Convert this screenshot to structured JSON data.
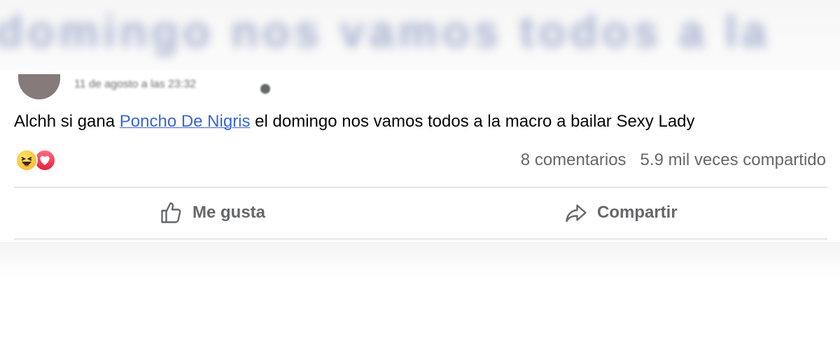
{
  "header": {
    "blurred_text": "domingo nos vamos todos a la",
    "date": "11 de agosto a las 23:32"
  },
  "post": {
    "text_before": "Alchh si gana ",
    "mention": "Poncho De Nigris",
    "text_after": " el domingo nos vamos todos a la macro a bailar Sexy Lady"
  },
  "reactions": [
    "haha-icon",
    "love-icon"
  ],
  "stats": {
    "comments": "8 comentarios",
    "shares": "5.9 mil veces compartido"
  },
  "actions": {
    "like_label": "Me gusta",
    "share_label": "Compartir"
  },
  "colors": {
    "link": "#3a66d3",
    "muted": "#65676b",
    "divider": "#ced0d4"
  }
}
